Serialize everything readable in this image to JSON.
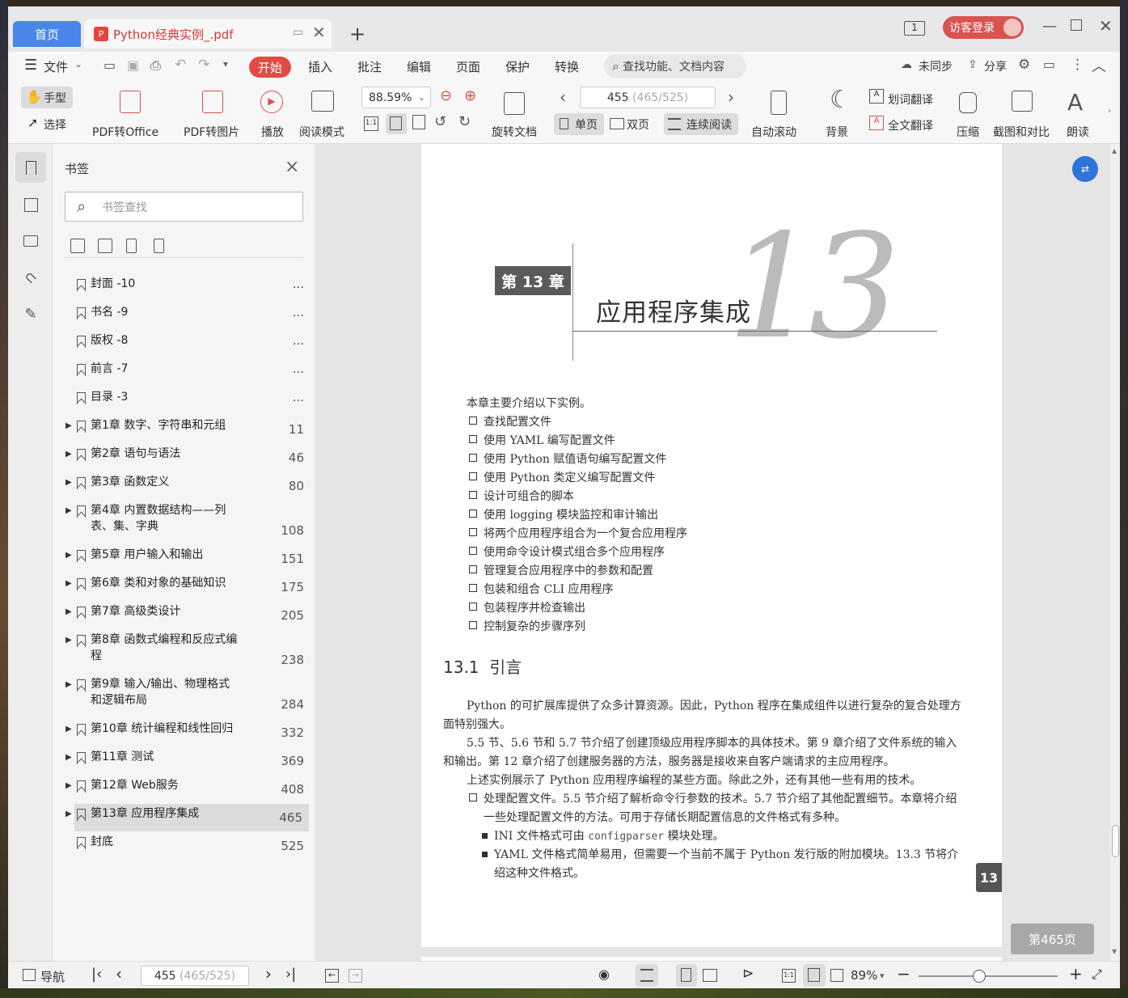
{
  "tabs": {
    "home": "首页",
    "document": "Python经典实例_.pdf"
  },
  "login": "访客登录",
  "menu": {
    "file": "文件",
    "items": [
      "开始",
      "插入",
      "批注",
      "编辑",
      "页面",
      "保护",
      "转换"
    ],
    "search_placeholder": "查找功能、文档内容",
    "sync": "未同步",
    "share": "分享"
  },
  "ribbon": {
    "hand": "手型",
    "select": "选择",
    "pdf_to_office": "PDF转Office",
    "pdf_to_image": "PDF转图片",
    "play": "播放",
    "read_mode": "阅读模式",
    "zoom": "88.59%",
    "rotate": "旋转文档",
    "page_current": "455",
    "page_total": "(465/525)",
    "single": "单页",
    "double": "双页",
    "continuous": "连续阅读",
    "auto_scroll": "自动滚动",
    "background": "背景",
    "word_translate": "划词翻译",
    "full_translate": "全文翻译",
    "compress": "压缩",
    "screenshot_compare": "截图和对比",
    "read_aloud": "朗读"
  },
  "bookmarks": {
    "title": "书签",
    "search_placeholder": "书签查找",
    "items": [
      {
        "label": "封面 -10",
        "page": "...",
        "expandable": false
      },
      {
        "label": "书名 -9",
        "page": "...",
        "expandable": false
      },
      {
        "label": "版权 -8",
        "page": "...",
        "expandable": false
      },
      {
        "label": "前言 -7",
        "page": "...",
        "expandable": false
      },
      {
        "label": "目录 -3",
        "page": "...",
        "expandable": false
      },
      {
        "label": "第1章 数字、字符串和元组",
        "page": "11",
        "expandable": true
      },
      {
        "label": "第2章 语句与语法",
        "page": "46",
        "expandable": true
      },
      {
        "label": "第3章 函数定义",
        "page": "80",
        "expandable": true
      },
      {
        "label": "第4章 内置数据结构——列表、集、字典",
        "page": "108",
        "expandable": true
      },
      {
        "label": "第5章 用户输入和输出",
        "page": "151",
        "expandable": true
      },
      {
        "label": "第6章 类和对象的基础知识",
        "page": "175",
        "expandable": true
      },
      {
        "label": "第7章 高级类设计",
        "page": "205",
        "expandable": true
      },
      {
        "label": "第8章 函数式编程和反应式编程",
        "page": "238",
        "expandable": true
      },
      {
        "label": "第9章 输入/输出、物理格式和逻辑布局",
        "page": "284",
        "expandable": true
      },
      {
        "label": "第10章 统计编程和线性回归",
        "page": "332",
        "expandable": true
      },
      {
        "label": "第11章 测试",
        "page": "369",
        "expandable": true
      },
      {
        "label": "第12章 Web服务",
        "page": "408",
        "expandable": true
      },
      {
        "label": "第13章 应用程序集成",
        "page": "465",
        "expandable": true,
        "active": true
      },
      {
        "label": "封底",
        "page": "525",
        "expandable": false
      }
    ]
  },
  "page": {
    "chapter_label": "第 13 章",
    "chapter_title": "应用程序集成",
    "chapter_number": "13",
    "intro": "本章主要介绍以下实例。",
    "recipes": [
      "查找配置文件",
      "使用 YAML 编写配置文件",
      "使用 Python 赋值语句编写配置文件",
      "使用 Python 类定义编写配置文件",
      "设计可组合的脚本",
      "使用 logging 模块监控和审计输出",
      "将两个应用程序组合为一个复合应用程序",
      "使用命令设计模式组合多个应用程序",
      "管理复合应用程序中的参数和配置",
      "包装和组合 CLI 应用程序",
      "包装程序并检查输出",
      "控制复杂的步骤序列"
    ],
    "section_number": "13.1",
    "section_title": "引言",
    "para1a": "Python 的可扩展库提供了众多计算资源。因此，Python 程序在集成组件以进行复杂的复合处理方",
    "para1b": "面特别强大。",
    "para2a": "5.5 节、5.6 节和 5.7 节介绍了创建顶级应用程序脚本的具体技术。第 9 章介绍了文件系统的输入",
    "para2b": "和输出。第 12 章介绍了创建服务器的方法，服务器是接收来自客户端请求的主应用程序。",
    "para3": "上述实例展示了 Python 应用程序编程的某些方面。除此之外，还有其他一些有用的技术。",
    "bullet1a": "处理配置文件。5.5 节介绍了解析命令行参数的技术。5.7 节介绍了其他配置细节。本章将介绍",
    "bullet1b": "一些处理配置文件的方法。可用于存储长期配置信息的文件格式有多种。",
    "sub1_pre": "INI 文件格式可由 ",
    "sub1_code": "configparser",
    "sub1_post": " 模块处理。",
    "sub2a": "YAML 文件格式简单易用，但需要一个当前不属于 Python 发行版的附加模块。13.3 节将介",
    "sub2b": "绍这种文件格式。",
    "side_tab": "13"
  },
  "page_label": "第465页",
  "status": {
    "nav": "导航",
    "page_current": "455",
    "page_total": "(465/525)",
    "zoom": "89%"
  },
  "colors": {
    "accent": "#4a86e8",
    "brand_red": "#e04b45"
  }
}
